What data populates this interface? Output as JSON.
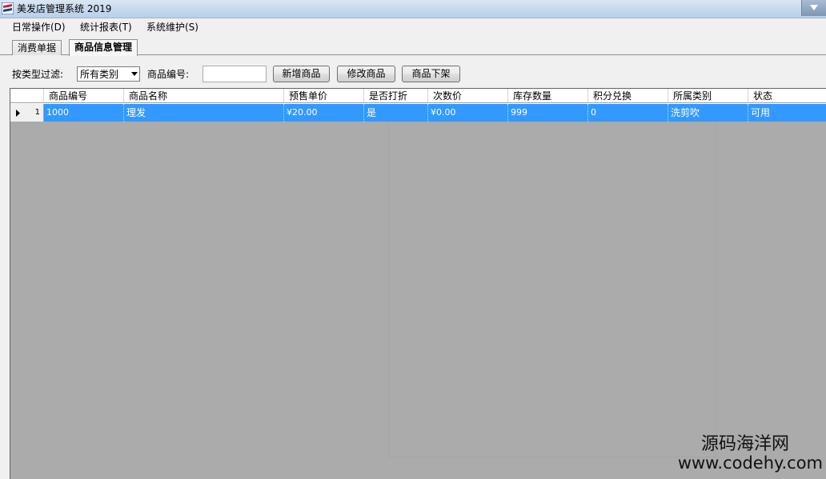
{
  "window": {
    "title": "美发店管理系统 2019"
  },
  "menu": [
    {
      "label": "日常操作(D)"
    },
    {
      "label": "统计报表(T)"
    },
    {
      "label": "系统维护(S)"
    }
  ],
  "tabs": [
    {
      "label": "消费单据",
      "active": false
    },
    {
      "label": "商品信息管理",
      "active": true
    }
  ],
  "toolbar": {
    "filter_label": "按类型过滤:",
    "filter_value": "所有类别",
    "code_label": "商品编号:",
    "code_value": "",
    "add_button": "新增商品",
    "edit_button": "修改商品",
    "remove_button": "商品下架"
  },
  "grid": {
    "columns": [
      "商品编号",
      "商品名称",
      "预售单价",
      "是否打折",
      "次数价",
      "库存数量",
      "积分兑换",
      "所属类别",
      "状态"
    ],
    "rows": [
      {
        "index": "1",
        "cells": [
          "1000",
          "理发",
          "¥20.00",
          "是",
          "¥0.00",
          "999",
          "0",
          "洗剪吹",
          "可用"
        ],
        "selected": true
      }
    ]
  },
  "watermark": {
    "line1": "源码海洋网",
    "line2": "www.codehy.com"
  },
  "colors": {
    "selection": "#3399ff",
    "grid_bg": "#ababab",
    "titlebar": "#c5d8ee"
  }
}
